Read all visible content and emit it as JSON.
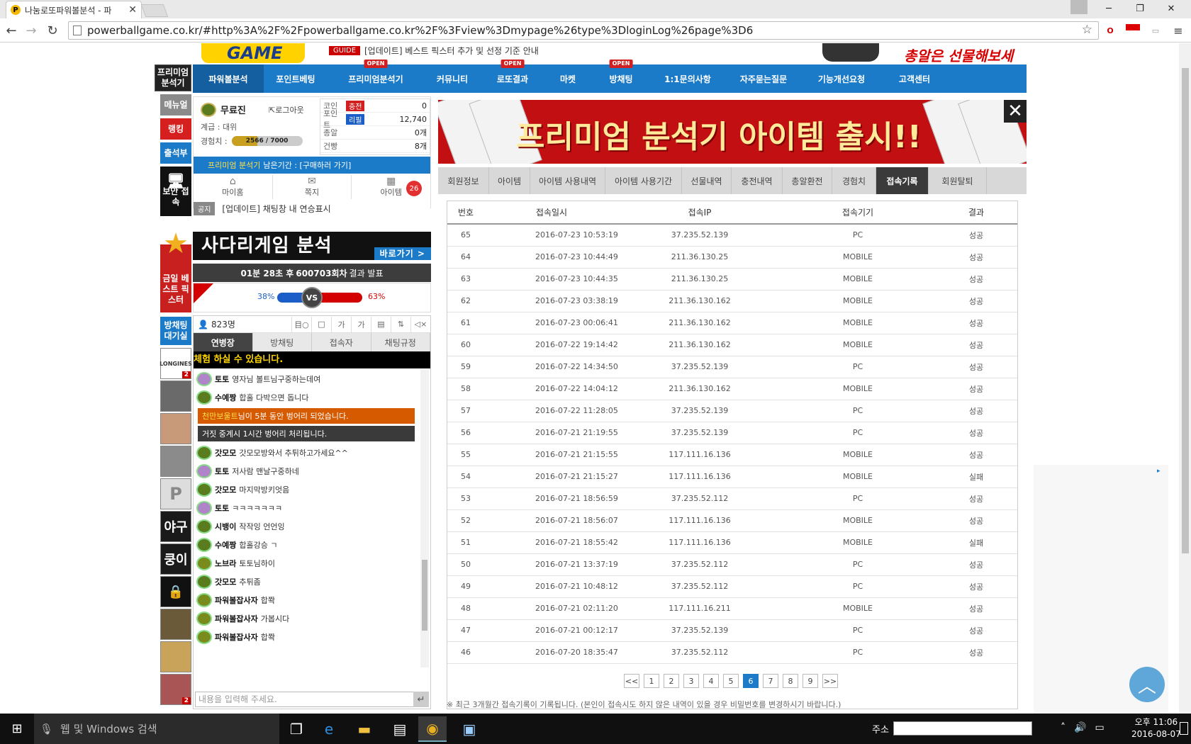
{
  "browser": {
    "tab_title": "나눔로또파워볼분석 - 파",
    "url": "powerballgame.co.kr/#http%3A%2F%2Fpowerballgame.co.kr%2F%3Fview%3Dmypage%26type%3DloginLog%26page%3D6"
  },
  "header": {
    "logo": "GAME",
    "guide_badge": "GUIDE",
    "guide_text": "[업데이트] 베스트 픽스터 추가 및 선정 기준 안내",
    "promo_text": "총알은 선물해보세요!!"
  },
  "nav": {
    "items": [
      {
        "label": "파워볼분석",
        "open": ""
      },
      {
        "label": "포인트베팅",
        "open": ""
      },
      {
        "label": "프리미엄분석기",
        "open": "OPEN"
      },
      {
        "label": "커뮤니티",
        "open": ""
      },
      {
        "label": "로또결과",
        "open": "OPEN"
      },
      {
        "label": "마켓",
        "open": ""
      },
      {
        "label": "방채팅",
        "open": "OPEN"
      },
      {
        "label": "1:1문의사항",
        "open": ""
      },
      {
        "label": "자주묻는질문",
        "open": ""
      },
      {
        "label": "기능개선요청",
        "open": ""
      },
      {
        "label": "고객센터",
        "open": ""
      }
    ]
  },
  "rail": {
    "premium": "프리미엄 분석기",
    "menu": "메뉴얼",
    "ranking": "랭킹",
    "attendance": "출석부",
    "secure": "보안 접속",
    "best": "금일 베스트 픽스터",
    "waiting": "방채팅 대기실",
    "thumbs": [
      "LONGINES",
      "",
      "",
      "",
      "P",
      "야구",
      "쿵이",
      "",
      "",
      "",
      ""
    ],
    "thumb_badges": [
      "2",
      "",
      "",
      "",
      "",
      "",
      "",
      "",
      "",
      "",
      "2"
    ]
  },
  "user": {
    "name": "무료진",
    "logout": "로그아웃",
    "rank": "계급 : 대위",
    "exp_label": "경험치 :",
    "exp_text": "2566 / 7000",
    "exp_fraction": 0.3666,
    "stats": [
      {
        "key": "코인",
        "badge": "충전",
        "badge_color": "#d21f1f",
        "value": "0"
      },
      {
        "key": "포인트",
        "badge": "리필",
        "badge_color": "#1b5ec8",
        "value": "12,740"
      },
      {
        "key": "총알",
        "badge": "",
        "badge_color": "",
        "value": "0개"
      },
      {
        "key": "건빵",
        "badge": "",
        "badge_color": "",
        "value": "8개"
      }
    ],
    "premium_label": "프리미엄 분석기",
    "premium_rest": "남은기간 : [구매하러 가기]",
    "quick": [
      "마이홈",
      "쪽지",
      "아이템"
    ],
    "item_count": "26",
    "notice_tag": "공지",
    "notice_text": "[업데이트] 채팅창 내 연승표시"
  },
  "ladder": {
    "title": "사다리게임 분석",
    "go": "바로가기 >",
    "countdown_time": "01분 28초 후",
    "countdown_round": "600703회차",
    "countdown_tail": "결과 발표",
    "left_pct": "38%",
    "right_pct": "63%",
    "vs": "VS"
  },
  "chat": {
    "count": "823명",
    "icons": [
      "目○",
      "□",
      "가",
      "가",
      "▤",
      "⇅",
      "◁×"
    ],
    "tabs": [
      "연병장",
      "방채팅",
      "접속자",
      "채팅규정"
    ],
    "marquee": "체험 하실 수 있습니다.",
    "messages": [
      {
        "type": "user",
        "nick": "토토",
        "text": "영자님 볼트님구중하는데여",
        "color": "#b084c9"
      },
      {
        "type": "user",
        "nick": "수예짱",
        "text": "합홀 다박으면 돕니다",
        "color": "#5a7b1e"
      },
      {
        "type": "sys",
        "nick": "천만보울트",
        "text": "님이 5분 동안 벙어리 되었습니다.",
        "bg": "#d65a00"
      },
      {
        "type": "sys",
        "nick": "",
        "text": "거짓 중계시 1시간 벙어리 처리됩니다.",
        "bg": "#3a3a3a"
      },
      {
        "type": "user",
        "nick": "갓모모",
        "text": "갓모모방와서 추튀하고가세요^^",
        "color": "#5a7b1e"
      },
      {
        "type": "user",
        "nick": "토토",
        "text": "저사람 맨날구중하네",
        "color": "#b084c9"
      },
      {
        "type": "user",
        "nick": "갓모모",
        "text": "마지막방키엇음",
        "color": "#5a7b1e"
      },
      {
        "type": "user",
        "nick": "토토",
        "text": "ㅋㅋㅋㅋㅋㅋㅋ",
        "color": "#b084c9"
      },
      {
        "type": "user",
        "nick": "시뱅이",
        "text": "작작잉 언언잉",
        "color": "#5a7b1e"
      },
      {
        "type": "user",
        "nick": "수예짱",
        "text": "합홀강승 ㄱ",
        "color": "#5a7b1e"
      },
      {
        "type": "user",
        "nick": "노브라",
        "text": "토토님하이",
        "color": "#7a8b1e"
      },
      {
        "type": "user",
        "nick": "갓모모",
        "text": "추튀좀",
        "color": "#5a7b1e"
      },
      {
        "type": "user",
        "nick": "파워볼잡사자",
        "text": "합쫙",
        "color": "#7a8b1e"
      },
      {
        "type": "user",
        "nick": "파워볼잡사자",
        "text": "가봅시다",
        "color": "#7a8b1e"
      },
      {
        "type": "user",
        "nick": "파워볼잡사자",
        "text": "합쫙",
        "color": "#7a8b1e"
      }
    ],
    "input_placeholder": "내용을 입력해 주세요."
  },
  "banner": {
    "text": "프리미엄 분석기 아이템 출시!!"
  },
  "mypage": {
    "tabs": [
      "회원정보",
      "아이템",
      "아이템 사용내역",
      "아이템 사용기간",
      "선물내역",
      "충전내역",
      "총알환전",
      "경험치",
      "접속기록",
      "회원탈퇴"
    ],
    "active_tab": 8,
    "columns": [
      "번호",
      "접속일시",
      "접속IP",
      "접속기기",
      "결과"
    ],
    "rows": [
      [
        "65",
        "2016-07-23 10:53:19",
        "37.235.52.139",
        "PC",
        "성공"
      ],
      [
        "64",
        "2016-07-23 10:44:49",
        "211.36.130.25",
        "MOBILE",
        "성공"
      ],
      [
        "63",
        "2016-07-23 10:44:35",
        "211.36.130.25",
        "MOBILE",
        "성공"
      ],
      [
        "62",
        "2016-07-23 03:38:19",
        "211.36.130.162",
        "MOBILE",
        "성공"
      ],
      [
        "61",
        "2016-07-23 00:06:41",
        "211.36.130.162",
        "MOBILE",
        "성공"
      ],
      [
        "60",
        "2016-07-22 19:14:42",
        "211.36.130.162",
        "MOBILE",
        "성공"
      ],
      [
        "59",
        "2016-07-22 14:34:50",
        "37.235.52.139",
        "PC",
        "성공"
      ],
      [
        "58",
        "2016-07-22 14:04:12",
        "211.36.130.162",
        "MOBILE",
        "성공"
      ],
      [
        "57",
        "2016-07-22 11:28:05",
        "37.235.52.139",
        "PC",
        "성공"
      ],
      [
        "56",
        "2016-07-21 21:19:55",
        "37.235.52.139",
        "PC",
        "성공"
      ],
      [
        "55",
        "2016-07-21 21:15:55",
        "117.111.16.136",
        "MOBILE",
        "성공"
      ],
      [
        "54",
        "2016-07-21 21:15:27",
        "117.111.16.136",
        "MOBILE",
        "실패"
      ],
      [
        "53",
        "2016-07-21 18:56:59",
        "37.235.52.112",
        "PC",
        "성공"
      ],
      [
        "52",
        "2016-07-21 18:56:07",
        "117.111.16.136",
        "MOBILE",
        "성공"
      ],
      [
        "51",
        "2016-07-21 18:55:42",
        "117.111.16.136",
        "MOBILE",
        "실패"
      ],
      [
        "50",
        "2016-07-21 13:37:19",
        "37.235.52.112",
        "PC",
        "성공"
      ],
      [
        "49",
        "2016-07-21 10:48:12",
        "37.235.52.112",
        "PC",
        "성공"
      ],
      [
        "48",
        "2016-07-21 02:11:20",
        "117.111.16.211",
        "MOBILE",
        "성공"
      ],
      [
        "47",
        "2016-07-21 00:12:17",
        "37.235.52.139",
        "PC",
        "성공"
      ],
      [
        "46",
        "2016-07-20 18:35:47",
        "37.235.52.112",
        "PC",
        "성공"
      ]
    ],
    "pages": [
      "<<",
      "1",
      "2",
      "3",
      "4",
      "5",
      "6",
      "7",
      "8",
      "9",
      ">>"
    ],
    "current_page": "6",
    "footnote": "※ 최근 3개월간 접속기록이 기록됩니다. (본인이 접속시도 하지 않은 내역이 있을 경우 비밀번호를 변경하시기 바랍니다.)"
  },
  "taskbar": {
    "search_placeholder": "웹 및 Windows 검색",
    "address_label": "주소",
    "time": "오후 11:06",
    "date": "2016-08-07"
  }
}
